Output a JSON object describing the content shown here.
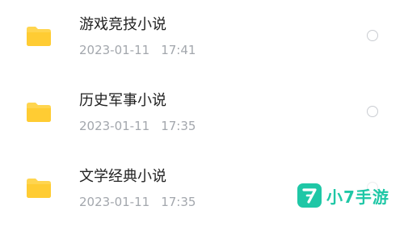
{
  "colors": {
    "folder": "#ffd54f",
    "folder_dark": "#f7c232",
    "title_text": "#222222",
    "meta_text": "#a3a7ad",
    "radio_border": "#c9ccd1",
    "watermark": "#1fc7a6"
  },
  "files": [
    {
      "icon": "folder-icon",
      "name": "游戏竞技小说",
      "date": "2023-01-11",
      "time": "17:41",
      "selected": false
    },
    {
      "icon": "folder-icon",
      "name": "历史军事小说",
      "date": "2023-01-11",
      "time": "17:35",
      "selected": false
    },
    {
      "icon": "folder-icon",
      "name": "文学经典小说",
      "date": "2023-01-11",
      "time": "17:35",
      "selected": false
    }
  ],
  "watermark": {
    "logo_icon": "seven-logo-icon",
    "text": "小7手游"
  }
}
